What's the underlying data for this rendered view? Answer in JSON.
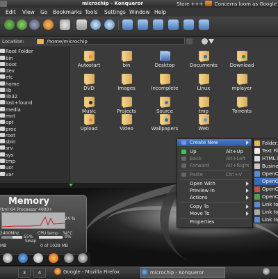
{
  "top_panel": {
    "window_title": "microchip - Konqueror",
    "ticker": "Store +++",
    "ticker2": "Concerns loom as Google b"
  },
  "menubar": [
    "Edit",
    "View",
    "Go",
    "Bookmarks",
    "Tools",
    "Settings",
    "Window",
    "Help"
  ],
  "location": {
    "label": "Location:",
    "value": "/home/microchip"
  },
  "sidebar": {
    "items": [
      "Root Folder",
      "bin",
      "boot",
      "dev",
      "etc",
      "home",
      "lib",
      "lib32",
      "lost+found",
      "media",
      "mnt",
      "opt",
      "proc",
      "root",
      "sbin",
      "srv",
      "sys",
      "tmp",
      "usr",
      "var"
    ]
  },
  "files": [
    {
      "name": "Autostart",
      "emblem": "#e89020"
    },
    {
      "name": "bin",
      "emblem": ""
    },
    {
      "name": "Desktop",
      "emblem": "#2a6fbd"
    },
    {
      "name": "Documents",
      "emblem": "#2a6fbd"
    },
    {
      "name": "Download",
      "emblem": "#2a8f3a"
    },
    {
      "name": "DVD",
      "emblem": ""
    },
    {
      "name": "Images",
      "emblem": ""
    },
    {
      "name": "Incomplete",
      "emblem": ""
    },
    {
      "name": "Linux",
      "emblem": ""
    },
    {
      "name": "mplayer",
      "emblem": ""
    },
    {
      "name": "Music",
      "emblem": "#2a2a2a"
    },
    {
      "name": "Projects",
      "emblem": ""
    },
    {
      "name": "Source",
      "emblem": "#3a7ad0"
    },
    {
      "name": "tmp",
      "emblem": ""
    },
    {
      "name": "Torrents",
      "emblem": ""
    },
    {
      "name": "Upload",
      "emblem": "#e89020"
    },
    {
      "name": "Video",
      "emblem": ""
    },
    {
      "name": "Wallpapers",
      "emblem": "#2a6fbd"
    },
    {
      "name": "Web",
      "emblem": "#5a9ad8"
    }
  ],
  "context_menu": {
    "create_new": "Create New",
    "up": "Up",
    "up_shortcut": "Alt+Up",
    "back": "Back",
    "back_shortcut": "Alt+Left",
    "forward": "Forward",
    "forward_shortcut": "Alt+Right",
    "paste": "Paste",
    "paste_shortcut": "Ctrl+V",
    "open_with": "Open With",
    "preview_in": "Preview In",
    "actions": "Actions",
    "copy_to": "Copy To",
    "move_to": "Move To",
    "properties": "Properties"
  },
  "submenu": {
    "items": [
      "Folder...",
      "Text File...",
      "HTML File...",
      "Business...",
      "OpenOffice...",
      "OpenOffice...",
      "OpenOffice...",
      "OpenOffice...",
      "Link to...",
      "Link to...",
      "Link to..."
    ]
  },
  "memory_widget": {
    "title": "Memory",
    "cpu_model": "(tm) 64 Processor 4000+",
    "load_pct": "24 %",
    "freq": "2400Mhz",
    "cpu_temp": "CPU temp : 34°C",
    "ram_pct": "55%",
    "swap_label": "Swap",
    "swap_pct": "0%",
    "ram_used": "MB",
    "swap_used": "0 of 1028 MB"
  },
  "taskbar": {
    "pager": [
      "3",
      "4"
    ],
    "firefox_task": "Google - Mozilla Firefox",
    "konqueror_task": "microchip - Konqueror"
  }
}
